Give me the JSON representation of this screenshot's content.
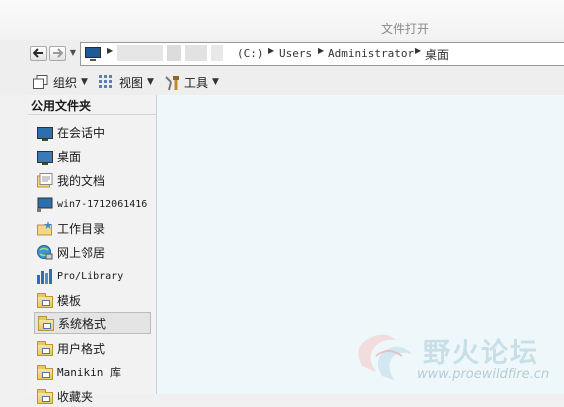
{
  "window": {
    "title": "文件打开"
  },
  "address": {
    "crumbs": [
      "(C:)",
      "Users",
      "Administrator",
      "桌面"
    ]
  },
  "toolbar": {
    "organize": "组织",
    "view": "视图",
    "tools": "工具"
  },
  "sidebar": {
    "header": "公用文件夹",
    "items": [
      {
        "label": "在会话中",
        "icon": "monitor-icon"
      },
      {
        "label": "桌面",
        "icon": "desktop-icon"
      },
      {
        "label": "我的文档",
        "icon": "documents-icon"
      },
      {
        "label": "win7-1712061416",
        "icon": "computer-icon"
      },
      {
        "label": "工作目录",
        "icon": "working-dir-icon"
      },
      {
        "label": "网上邻居",
        "icon": "network-icon"
      },
      {
        "label": "Pro/Library",
        "icon": "library-icon"
      },
      {
        "label": "模板",
        "icon": "folder-icon"
      },
      {
        "label": "系统格式",
        "icon": "folder-icon",
        "selected": true
      },
      {
        "label": "用户格式",
        "icon": "folder-icon"
      },
      {
        "label": "Manikin 库",
        "icon": "folder-icon"
      },
      {
        "label": "收藏夹",
        "icon": "favorites-icon"
      }
    ]
  },
  "watermark": {
    "text": "野火论坛",
    "url": "www.proewildfire.cn"
  },
  "colors": {
    "content_bg": "#eef8fb",
    "toolbar_bg": "#eeeeee",
    "selection_bg": "#e4e4e4"
  }
}
